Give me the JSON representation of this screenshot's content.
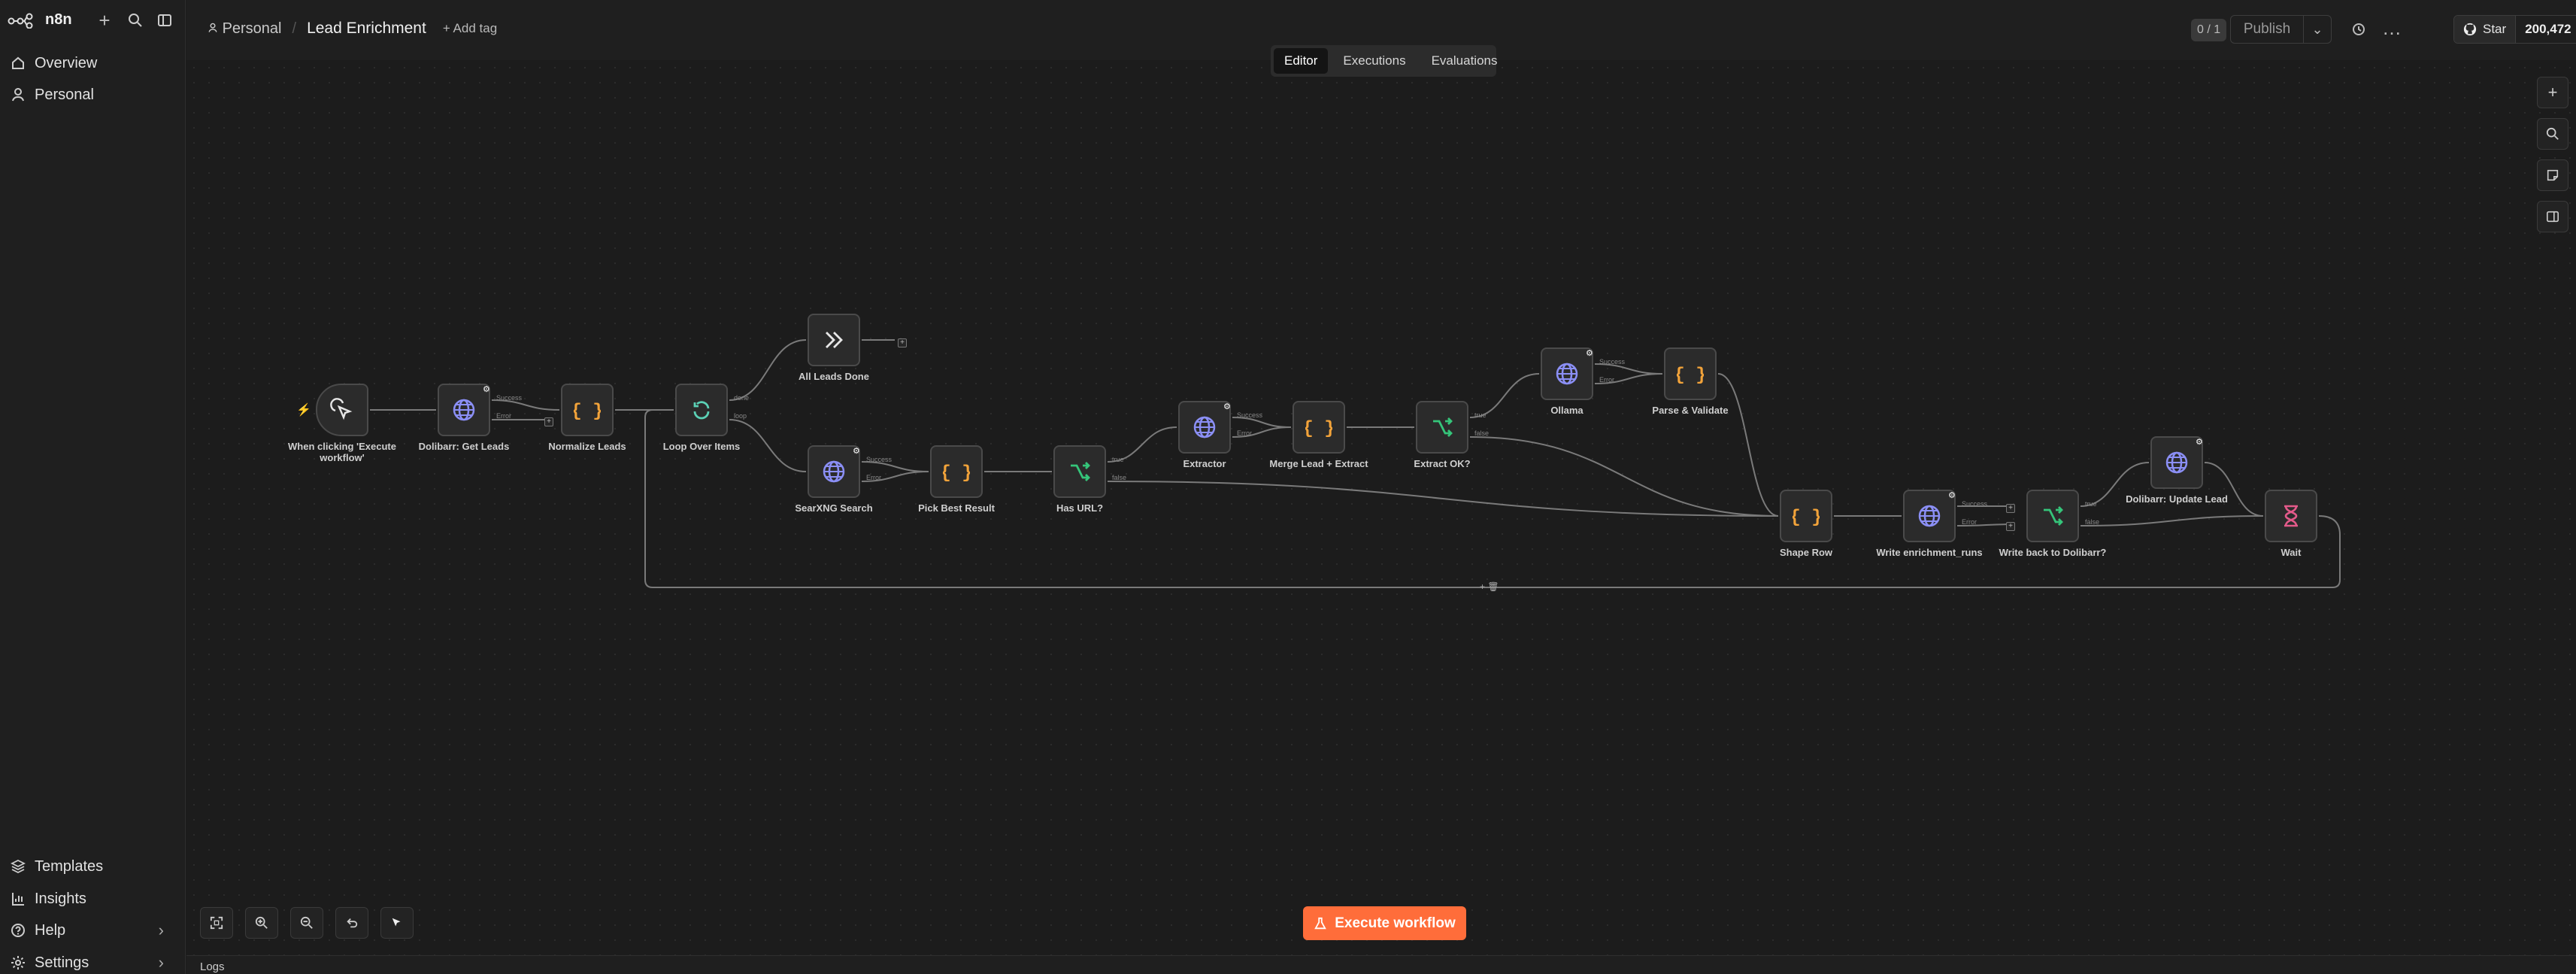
{
  "app": {
    "name": "n8n"
  },
  "sidebar": {
    "nav": [
      {
        "label": "Overview",
        "icon": "home-icon"
      },
      {
        "label": "Personal",
        "icon": "user-icon"
      }
    ],
    "bottom": [
      {
        "label": "Templates",
        "icon": "templates-icon"
      },
      {
        "label": "Insights",
        "icon": "insights-icon"
      },
      {
        "label": "Help",
        "icon": "help-icon"
      },
      {
        "label": "Settings",
        "icon": "settings-icon"
      }
    ]
  },
  "header": {
    "project": "Personal",
    "workflow_title": "Lead Enrichment",
    "add_tag": "+ Add tag",
    "counter": "0 / 1",
    "publish": "Publish",
    "github_star": "Star",
    "github_count": "200,472"
  },
  "tabs": [
    {
      "label": "Editor",
      "active": true
    },
    {
      "label": "Executions",
      "active": false
    },
    {
      "label": "Evaluations",
      "active": false
    }
  ],
  "workflow": {
    "nodes": [
      {
        "id": "trigger",
        "label": "When clicking 'Execute workflow'",
        "type": "trigger"
      },
      {
        "id": "getleads",
        "label": "Dolibarr: Get Leads",
        "type": "http"
      },
      {
        "id": "normalize",
        "label": "Normalize Leads",
        "type": "code"
      },
      {
        "id": "loop",
        "label": "Loop Over Items",
        "type": "loop"
      },
      {
        "id": "alldone",
        "label": "All Leads Done",
        "type": "noop"
      },
      {
        "id": "searx",
        "label": "SearXNG Search",
        "type": "http"
      },
      {
        "id": "pickbest",
        "label": "Pick Best Result",
        "type": "code"
      },
      {
        "id": "hasurl",
        "label": "Has URL?",
        "type": "if"
      },
      {
        "id": "extractor",
        "label": "Extractor",
        "type": "http"
      },
      {
        "id": "merge",
        "label": "Merge Lead + Extract",
        "type": "code"
      },
      {
        "id": "extractok",
        "label": "Extract OK?",
        "type": "if"
      },
      {
        "id": "ollama",
        "label": "Ollama",
        "type": "http"
      },
      {
        "id": "parse",
        "label": "Parse & Validate",
        "type": "code"
      },
      {
        "id": "shape",
        "label": "Shape Row",
        "type": "code"
      },
      {
        "id": "writeruns",
        "label": "Write enrichment_runs",
        "type": "http"
      },
      {
        "id": "writeback",
        "label": "Write back to Dolibarr?",
        "type": "if"
      },
      {
        "id": "update",
        "label": "Dolibarr: Update Lead",
        "type": "http"
      },
      {
        "id": "wait",
        "label": "Wait",
        "type": "wait"
      }
    ],
    "port_labels": {
      "success": "Success",
      "error": "Error",
      "true": "true",
      "false": "false",
      "done": "done",
      "loop": "loop"
    }
  },
  "execute_button": "Execute workflow",
  "logs_label": "Logs",
  "colors": {
    "accent": "#ff6d3a",
    "http": "#8b8ff5",
    "code": "#f2a33a",
    "if": "#35c57a",
    "loop": "#5bd0b5",
    "wait": "#e35a8a"
  }
}
